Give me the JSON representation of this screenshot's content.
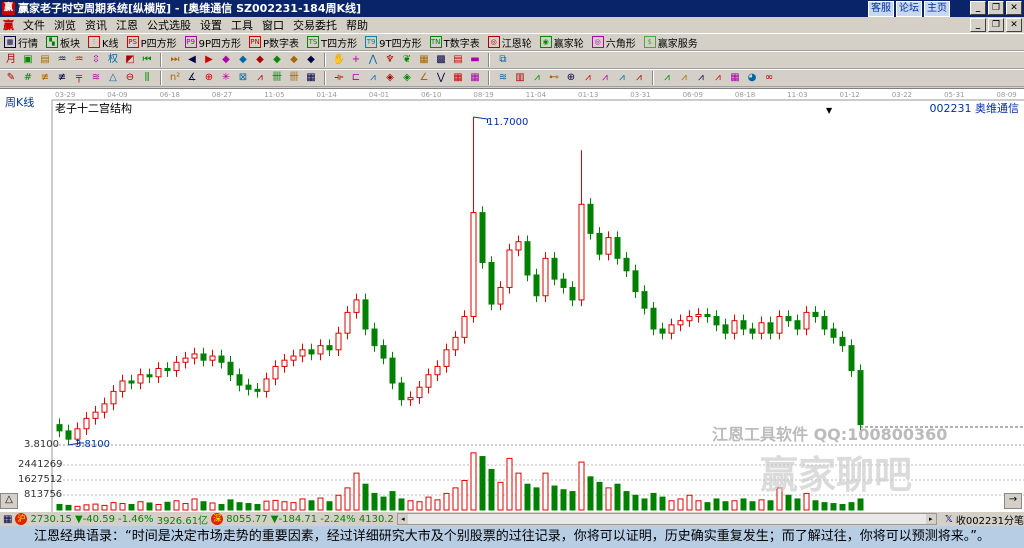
{
  "window": {
    "title": "赢家老子时空周期系统[纵横版] - [奥维通信   SZ002231-184周K线]",
    "app_icon": "赢",
    "links": [
      "客服",
      "论坛",
      "主页"
    ]
  },
  "menu": {
    "logo": "赢",
    "items": [
      "文件",
      "浏览",
      "资讯",
      "江恩",
      "公式选股",
      "设置",
      "工具",
      "窗口",
      "交易委托",
      "帮助"
    ]
  },
  "toolbar1": [
    {
      "icon": "quote-board-icon",
      "glyph": "▦",
      "label": "行情",
      "color": "#004"
    },
    {
      "icon": "sector-icon",
      "glyph": "▚",
      "label": "板块",
      "color": "#070"
    },
    {
      "icon": "kline-icon",
      "glyph": "⫶",
      "label": "K线",
      "color": "#c00"
    },
    {
      "icon": "p-square-icon",
      "glyph": "PS",
      "label": "P四方形",
      "color": "#c00"
    },
    {
      "icon": "p9-icon",
      "glyph": "P9",
      "label": "9P四方形",
      "color": "#a0a"
    },
    {
      "icon": "pn-icon",
      "glyph": "PN",
      "label": "P数字表",
      "color": "#c00"
    },
    {
      "icon": "t-square-icon",
      "glyph": "TS",
      "label": "T四方形",
      "color": "#080"
    },
    {
      "icon": "t9-icon",
      "glyph": "T9",
      "label": "9T四方形",
      "color": "#08a"
    },
    {
      "icon": "tn-icon",
      "glyph": "TN",
      "label": "T数字表",
      "color": "#080"
    },
    {
      "icon": "gann-wheel-icon",
      "glyph": "◎",
      "label": "江恩轮",
      "color": "#a00"
    },
    {
      "icon": "winner-wheel-icon",
      "glyph": "◉",
      "label": "赢家轮",
      "color": "#080"
    },
    {
      "icon": "hexagon-icon",
      "glyph": "◎",
      "label": "六角形",
      "color": "#a0a"
    },
    {
      "icon": "service-icon",
      "glyph": "$",
      "label": "赢家服务",
      "color": "#4a4"
    }
  ],
  "toolbar2": [
    [
      "period-icon",
      "月"
    ],
    [
      "zoom-icon",
      "▣"
    ],
    [
      "list-icon",
      "▤"
    ],
    [
      "wave-icon",
      "♒"
    ],
    [
      "wave2-icon",
      "♒"
    ],
    [
      "candle-select-icon",
      "⇳"
    ],
    [
      "weight-icon",
      "权"
    ],
    [
      "color-icon",
      "◩"
    ],
    [
      "first-icon",
      "⏮"
    ],
    [
      "last-icon",
      "⏭"
    ],
    [
      "left-icon",
      "◀"
    ],
    [
      "right-icon",
      "▶"
    ],
    [
      "diamond1-icon",
      "◆"
    ],
    [
      "diamond2-icon",
      "◆"
    ],
    [
      "diamond3-icon",
      "◆"
    ],
    [
      "diamond4-icon",
      "◆"
    ],
    [
      "diamond5-icon",
      "◆"
    ],
    [
      "diamond6-icon",
      "◆"
    ],
    [
      "hand-icon",
      "✋"
    ],
    [
      "cross-icon",
      "+"
    ],
    [
      "line-icon",
      "⋀"
    ],
    [
      "tool-icon",
      "♆"
    ],
    [
      "formula-icon",
      "❦"
    ],
    [
      "calendar-icon",
      "▦"
    ],
    [
      "calc-icon",
      "▩"
    ],
    [
      "notes-icon",
      "▤"
    ],
    [
      "save-icon",
      "▬"
    ],
    [
      "export-icon",
      "⧉"
    ]
  ],
  "toolbar3": [
    [
      "draw-icon",
      "✎"
    ],
    [
      "grid1-icon",
      "#"
    ],
    [
      "grid2-icon",
      "≢"
    ],
    [
      "grid3-icon",
      "≢"
    ],
    [
      "grid4-icon",
      "╤"
    ],
    [
      "grid5-icon",
      "≋"
    ],
    [
      "triangle-icon",
      "△"
    ],
    [
      "circle-icon",
      "⊖"
    ],
    [
      "lines-icon",
      "⫼"
    ],
    [
      "n2-icon",
      "n²"
    ],
    [
      "angle-icon",
      "∡"
    ],
    [
      "target-icon",
      "⊕"
    ],
    [
      "star-icon",
      "✳"
    ],
    [
      "box-icon",
      "⊠"
    ],
    [
      "wedge-icon",
      "⩘"
    ],
    [
      "gann1-icon",
      "卌"
    ],
    [
      "gann2-icon",
      "卌"
    ],
    [
      "matrix-icon",
      "▦"
    ],
    [
      "split-icon",
      "⟛"
    ],
    [
      "frame-icon",
      "⊏"
    ],
    [
      "fan-icon",
      "⩘"
    ],
    [
      "fan2-icon",
      "◈"
    ],
    [
      "fan3-icon",
      "◈"
    ],
    [
      "angle2-icon",
      "∠"
    ],
    [
      "v-icon",
      "⋁"
    ],
    [
      "grid6-icon",
      "▦"
    ],
    [
      "grid7-icon",
      "▦"
    ],
    [
      "fib-icon",
      "≋"
    ],
    [
      "bars-icon",
      "▥"
    ],
    [
      "a1-icon",
      "⩘"
    ],
    [
      "a2-icon",
      "⊷"
    ],
    [
      "a3-icon",
      "⊕"
    ],
    [
      "a4-icon",
      "⩘"
    ],
    [
      "a5-icon",
      "⩘"
    ],
    [
      "a6-icon",
      "⩘"
    ],
    [
      "a7-icon",
      "⩘"
    ],
    [
      "a8-icon",
      "⩘"
    ],
    [
      "a9-icon",
      "⩘"
    ],
    [
      "a10-icon",
      "⩘"
    ],
    [
      "a11-icon",
      "⩘"
    ],
    [
      "a12-icon",
      "▦"
    ],
    [
      "pie-icon",
      "◕"
    ],
    [
      "loop-icon",
      "∞"
    ]
  ],
  "chart": {
    "period_label": "周K线",
    "indicator_title": "老子十二宫结构",
    "stock_label": "002231  奥维通信",
    "dates": [
      "03-29",
      "04-09",
      "06-18",
      "08-27",
      "11-05",
      "01-14",
      "04-01",
      "06-10",
      "08-19",
      "11-04",
      "01-13",
      "03-31",
      "06-09",
      "08-18",
      "11-03",
      "01-12",
      "03-22",
      "05-31",
      "08-09"
    ],
    "low_label": "3.8100",
    "low_annotation": "3.8100",
    "high_annotation": "11.7000",
    "volume_ticks": [
      "2441269",
      "1627512",
      "813756"
    ],
    "watermark_text": "江恩工具软件  QQ:100800360",
    "watermark_logo": "赢家聊吧",
    "up_color": "#e00000",
    "down_color": "#008000"
  },
  "chart_data": {
    "type": "candlestick",
    "title": "老子十二宫结构",
    "ylim": [
      3.81,
      11.7
    ],
    "close": [
      4.15,
      3.95,
      4.2,
      4.45,
      4.6,
      4.8,
      5.1,
      5.35,
      5.3,
      5.5,
      5.45,
      5.65,
      5.6,
      5.8,
      5.9,
      6.0,
      5.85,
      5.95,
      5.8,
      5.5,
      5.25,
      5.15,
      5.1,
      5.4,
      5.7,
      5.85,
      5.95,
      6.1,
      6.0,
      6.2,
      6.1,
      6.5,
      7.0,
      7.3,
      6.6,
      6.2,
      5.9,
      5.3,
      4.9,
      4.95,
      5.2,
      5.5,
      5.7,
      6.1,
      6.4,
      6.9,
      9.4,
      8.2,
      7.2,
      7.6,
      8.5,
      8.7,
      7.9,
      7.4,
      8.3,
      7.8,
      7.6,
      7.3,
      9.6,
      8.9,
      8.4,
      8.8,
      8.3,
      8.0,
      7.5,
      7.1,
      6.6,
      6.5,
      6.7,
      6.8,
      6.9,
      6.95,
      6.9,
      6.7,
      6.5,
      6.8,
      6.6,
      6.5,
      6.75,
      6.5,
      6.9,
      6.8,
      6.6,
      7.0,
      6.9,
      6.6,
      6.4,
      6.2,
      5.6,
      4.3
    ],
    "first_open": 4.3,
    "high_overrides": {
      "46": 11.7,
      "58": 10.9
    },
    "low_overrides": {
      "1": 3.81
    },
    "volume": [
      300000,
      250000,
      200000,
      280000,
      320000,
      250000,
      400000,
      350000,
      300000,
      450000,
      380000,
      300000,
      420000,
      500000,
      350000,
      600000,
      450000,
      380000,
      300000,
      550000,
      400000,
      350000,
      300000,
      480000,
      520000,
      450000,
      400000,
      600000,
      500000,
      650000,
      450000,
      800000,
      1200000,
      2000000,
      1400000,
      900000,
      700000,
      1000000,
      600000,
      500000,
      450000,
      700000,
      550000,
      900000,
      1200000,
      1600000,
      3100000,
      2900000,
      2200000,
      1500000,
      2800000,
      2000000,
      1400000,
      1200000,
      2000000,
      1300000,
      1100000,
      1000000,
      2600000,
      1800000,
      1500000,
      1200000,
      1400000,
      1000000,
      800000,
      600000,
      900000,
      700000,
      500000,
      600000,
      800000,
      500000,
      400000,
      600000,
      450000,
      500000,
      600000,
      450000,
      550000,
      500000,
      1200000,
      800000,
      600000,
      900000,
      500000,
      400000,
      350000,
      300000,
      400000,
      600000
    ],
    "volume_max": 3255025
  },
  "status": {
    "sh_index": "2730.15",
    "sh_change": "▼-40.59",
    "sh_pct": "-1.46%",
    "sh_amount": "3926.61亿",
    "sz_index": "8055.77",
    "sz_change": "▼-184.71",
    "sz_pct": "-2.24%",
    "sz_amount": "4130.2",
    "receive": "收002231分笔"
  },
  "quote": "江恩经典语录：“时间是决定市场走势的重要因素，经过详细研究大市及个别股票的过往记录，你将可以证明，历史确实重复发生；而了解过往，你将可以预测将来。”。"
}
